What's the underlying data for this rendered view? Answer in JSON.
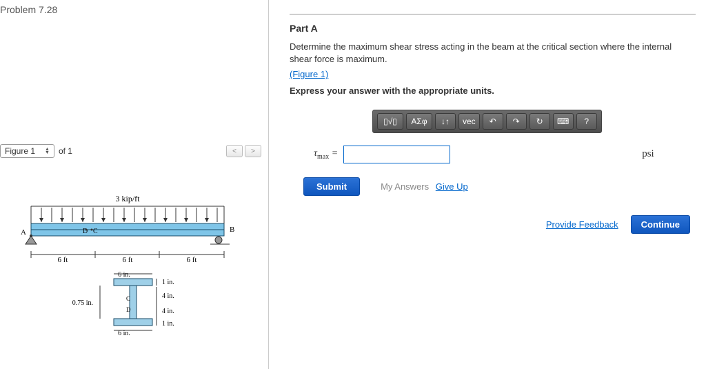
{
  "problem": {
    "title": "Problem 7.28"
  },
  "figure_nav": {
    "label": "Figure 1",
    "of": "of 1",
    "prev": "<",
    "next": ">"
  },
  "figure": {
    "load": "3 kip/ft",
    "dims": {
      "span1": "6 ft",
      "span2": "6 ft",
      "span3": "6 ft"
    },
    "cs": {
      "flange_w": "6 in.",
      "flange_t": "1 in.",
      "web_t": "0.75 in.",
      "half_h": "4 in.",
      "bot_flange_w": "6 in.",
      "bot_flange_t": "1 in."
    },
    "labels": {
      "A": "A",
      "B": "B",
      "C": "C",
      "D": "D"
    }
  },
  "part": {
    "heading": "Part A",
    "prompt": "Determine the maximum shear stress acting in the beam at the critical section where the internal shear force is maximum.",
    "figure_link": "(Figure 1)",
    "express": "Express your answer with the appropriate units."
  },
  "toolbar": {
    "templates": "▯√▯",
    "greek": "ΑΣφ",
    "updown": "↓↑",
    "vec": "vec",
    "undo": "↶",
    "redo": "↷",
    "reset": "↻",
    "keyboard": "⌨",
    "help": "?"
  },
  "answer": {
    "var_html": "τ<sub>max</sub> =",
    "value": "",
    "unit": "psi"
  },
  "actions": {
    "submit": "Submit",
    "my_answers": "My Answers",
    "give_up": "Give Up",
    "feedback": "Provide Feedback",
    "continue": "Continue"
  }
}
